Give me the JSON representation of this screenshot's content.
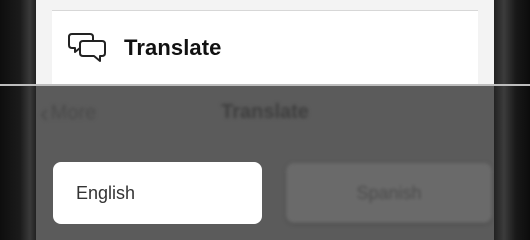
{
  "menu": {
    "item_label": "Translate",
    "item_icon": "speech-bubbles-icon"
  },
  "background_screen": {
    "back_label": "More",
    "title": "Translate",
    "languages": {
      "source": "English",
      "target": "Spanish"
    }
  }
}
